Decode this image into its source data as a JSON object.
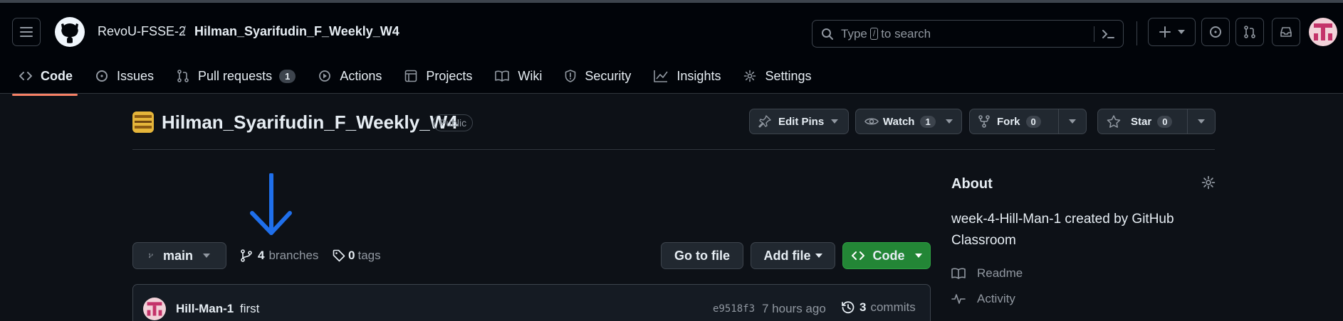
{
  "header": {
    "org": "RevoU-FSSE-2",
    "separator": "/",
    "repo": "Hilman_Syarifudin_F_Weekly_W4",
    "search": {
      "prefix": "Type",
      "key": "/",
      "suffix": "to search"
    }
  },
  "tabs": [
    {
      "label": "Code"
    },
    {
      "label": "Issues"
    },
    {
      "label": "Pull requests",
      "count": "1"
    },
    {
      "label": "Actions"
    },
    {
      "label": "Projects"
    },
    {
      "label": "Wiki"
    },
    {
      "label": "Security"
    },
    {
      "label": "Insights"
    },
    {
      "label": "Settings"
    }
  ],
  "repo": {
    "title": "Hilman_Syarifudin_F_Weekly_W4",
    "visibility": "Public",
    "edit_pins": "Edit Pins",
    "watch": "Watch",
    "watch_count": "1",
    "fork": "Fork",
    "fork_count": "0",
    "star": "Star",
    "star_count": "0"
  },
  "toolbar": {
    "branch": "main",
    "branches_count": "4",
    "branches_label": "branches",
    "tags_count": "0",
    "tags_label": "tags",
    "go_to_file": "Go to file",
    "add_file": "Add file",
    "code": "Code"
  },
  "commit": {
    "author": "Hill-Man-1",
    "message": "first",
    "sha": "e9518f3",
    "time": "7 hours ago",
    "count": "3",
    "count_label": "commits"
  },
  "about": {
    "title": "About",
    "description": "week-4-Hill-Man-1 created by GitHub Classroom",
    "links": [
      "Readme",
      "Activity"
    ]
  },
  "colors": {
    "accent_tab": "#f78166",
    "code_button": "#238636",
    "arrow": "#1f6feb"
  }
}
